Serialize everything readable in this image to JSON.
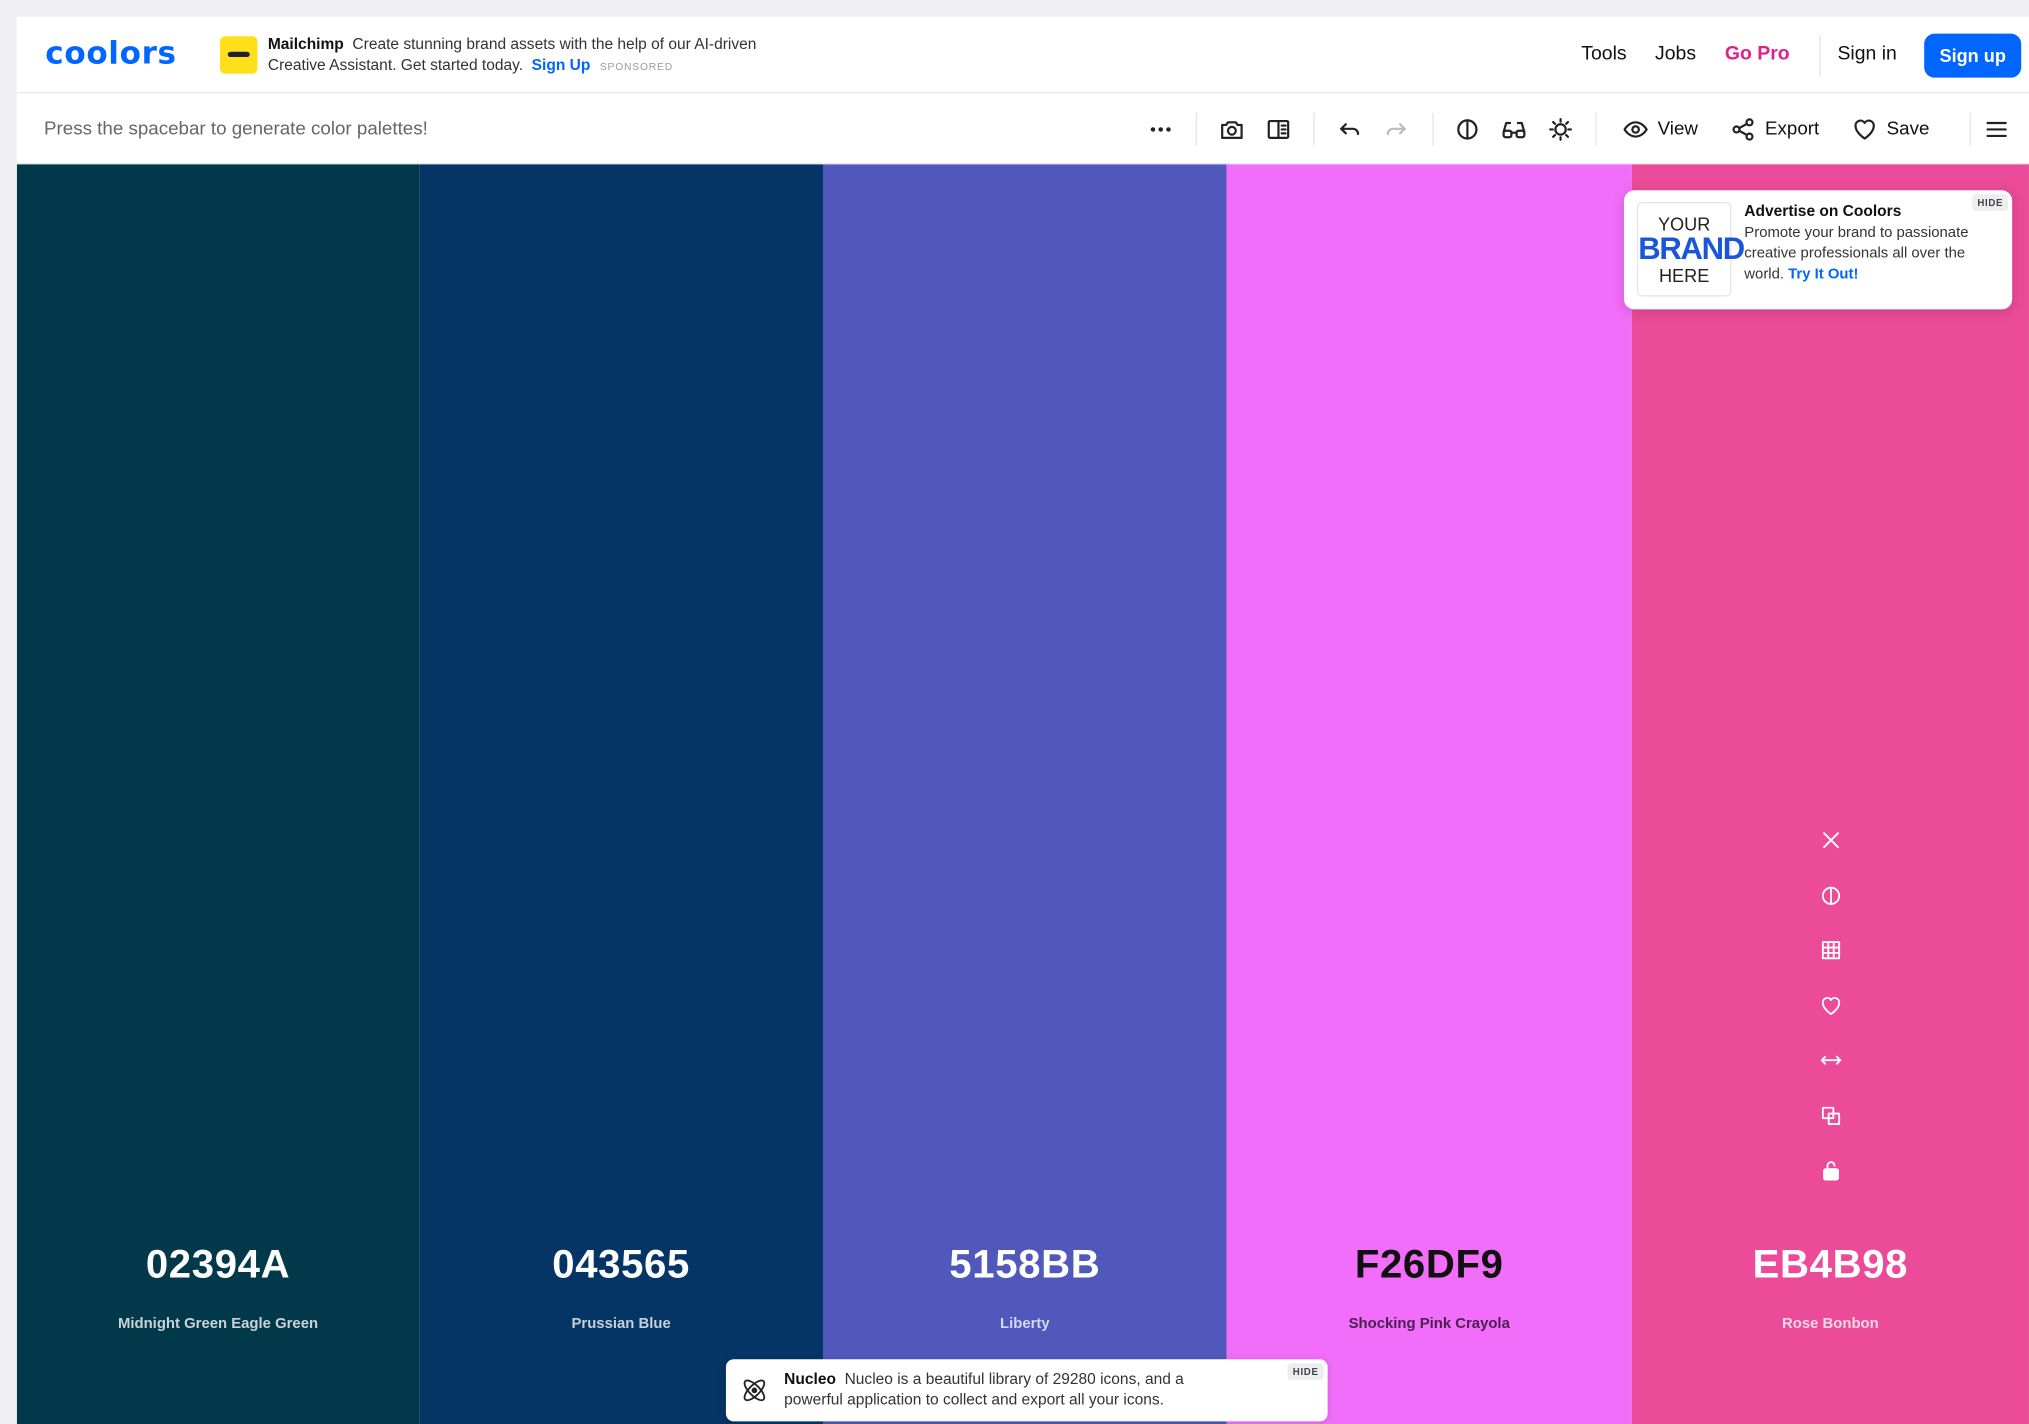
{
  "nav": {
    "logo": "coolors",
    "ad": {
      "brand": "Mailchimp",
      "text": "Create stunning brand assets with the help of our AI-driven Creative Assistant. Get started today.",
      "link": "Sign Up",
      "sponsored": "SPONSORED"
    },
    "tools": "Tools",
    "jobs": "Jobs",
    "gopro": "Go Pro",
    "signin": "Sign in",
    "signup": "Sign up"
  },
  "toolbar": {
    "hint": "Press the spacebar to generate color palettes!",
    "view": "View",
    "export": "Export",
    "save": "Save",
    "icons": [
      "more-icon",
      "camera-icon",
      "panel-icon",
      "undo-icon",
      "redo-icon",
      "contrast-icon",
      "glasses-icon",
      "sun-icon",
      "eye-icon",
      "share-icon",
      "heart-icon",
      "menu-icon"
    ]
  },
  "palette": [
    {
      "hex": "02394A",
      "name": "Midnight Green Eagle Green",
      "color": "#02394A",
      "text_color": "#ffffff",
      "name_color": "#c9d3d6"
    },
    {
      "hex": "043565",
      "name": "Prussian Blue",
      "color": "#043565",
      "text_color": "#ffffff",
      "name_color": "#c7d0da"
    },
    {
      "hex": "5158BB",
      "name": "Liberty",
      "color": "#5158BB",
      "text_color": "#ffffff",
      "name_color": "#d6d8ee"
    },
    {
      "hex": "F26DF9",
      "name": "Shocking Pink Crayola",
      "color": "#F26DF9",
      "text_color": "#111111",
      "name_color": "#4a2150"
    },
    {
      "hex": "EB4B98",
      "name": "Rose Bonbon",
      "color": "#EB4B98",
      "text_color": "#ffffff",
      "name_color": "#fbd6e7"
    }
  ],
  "swatch_icons": [
    "close-icon",
    "contrast-icon",
    "grid-icon",
    "heart-icon",
    "drag-icon",
    "copy-icon",
    "lock-icon"
  ],
  "ad_card": {
    "brand_top": "YOUR",
    "brand_mid": "BRAND",
    "brand_bottom": "HERE",
    "title": "Advertise on Coolors",
    "body": "Promote your brand to passionate creative professionals all over the world.",
    "link": "Try It Out!",
    "hide": "HIDE"
  },
  "ad_bottom": {
    "brand": "Nucleo",
    "text": "Nucleo is a beautiful library of 29280 icons, and a powerful application to collect and export all your icons.",
    "hide": "HIDE"
  }
}
